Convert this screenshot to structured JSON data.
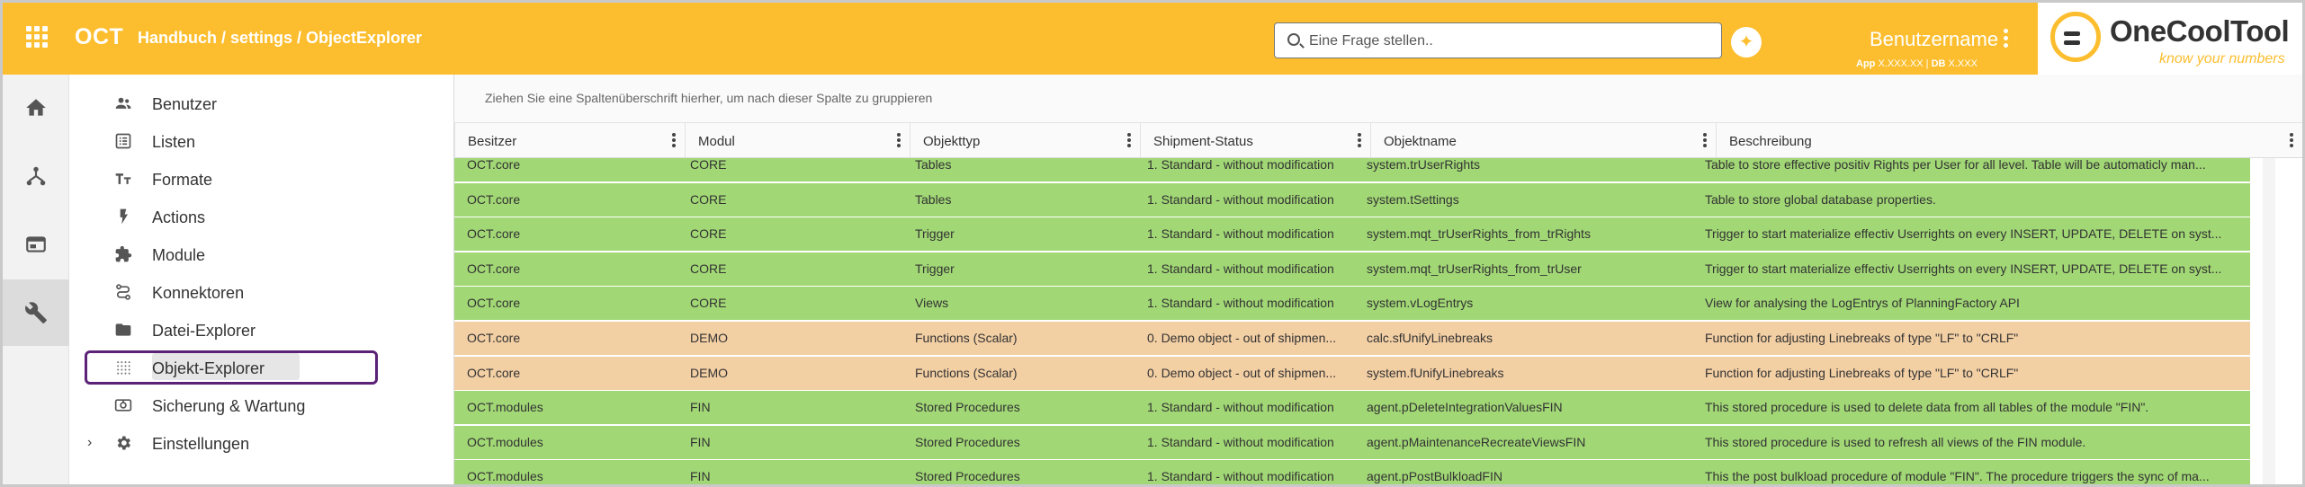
{
  "header": {
    "app_name": "OCT",
    "breadcrumb": "Handbuch / settings / ObjectExplorer",
    "search_placeholder": "Eine Frage stellen..",
    "ai_button_icon": "sparkle-icon",
    "username": "Benutzername",
    "app_version_label": "App",
    "app_version": "X.XXX.XX",
    "db_version_label": "DB",
    "db_version": "X.XXX",
    "logo_text": "OneCoolTool",
    "logo_tagline": "know your numbers",
    "accent_color": "#fcbe2e"
  },
  "rail": [
    {
      "icon": "home-icon"
    },
    {
      "icon": "hierarchy-icon"
    },
    {
      "icon": "window-icon"
    },
    {
      "icon": "wrench-icon",
      "active": true
    }
  ],
  "nav": {
    "items": [
      {
        "label": "Benutzer",
        "icon": "users-icon"
      },
      {
        "label": "Listen",
        "icon": "list-icon"
      },
      {
        "label": "Formate",
        "icon": "text-format-icon"
      },
      {
        "label": "Actions",
        "icon": "lightning-icon"
      },
      {
        "label": "Module",
        "icon": "puzzle-icon"
      },
      {
        "label": "Konnektoren",
        "icon": "connector-icon"
      },
      {
        "label": "Datei-Explorer",
        "icon": "folder-icon"
      },
      {
        "label": "Objekt-Explorer",
        "icon": "grid-dots-icon",
        "selected": true
      },
      {
        "label": "Sicherung & Wartung",
        "icon": "backup-icon"
      },
      {
        "label": "Einstellungen",
        "icon": "gear-icon",
        "expandable": true
      }
    ]
  },
  "grid": {
    "group_hint": "Ziehen Sie eine Spaltenüberschrift hierher, um nach dieser Spalte zu gruppieren",
    "columns": [
      "Besitzer",
      "Modul",
      "Objekttyp",
      "Shipment-Status",
      "Objektname",
      "Beschreibung"
    ],
    "row_colors": {
      "green": "#a1d775",
      "orange": "#f3cfa4"
    },
    "rows": [
      {
        "status": "green",
        "cells": [
          "OCT.core",
          "CORE",
          "Tables",
          "1. Standard - without modification",
          "system.trUserRights",
          "Table to store effective positiv Rights per User for all level. Table will be automaticly man..."
        ]
      },
      {
        "status": "green",
        "cells": [
          "OCT.core",
          "CORE",
          "Tables",
          "1. Standard - without modification",
          "system.tSettings",
          "Table to store global database properties."
        ]
      },
      {
        "status": "green",
        "cells": [
          "OCT.core",
          "CORE",
          "Trigger",
          "1. Standard - without modification",
          "system.mqt_trUserRights_from_trRights",
          "Trigger to start materialize effectiv Userrights on every INSERT, UPDATE, DELETE on syst..."
        ]
      },
      {
        "status": "green",
        "cells": [
          "OCT.core",
          "CORE",
          "Trigger",
          "1. Standard - without modification",
          "system.mqt_trUserRights_from_trUser",
          "Trigger to start materialize effectiv Userrights on every INSERT, UPDATE, DELETE on syst..."
        ]
      },
      {
        "status": "green",
        "cells": [
          "OCT.core",
          "CORE",
          "Views",
          "1. Standard - without modification",
          "system.vLogEntrys",
          "View for analysing the LogEntrys of PlanningFactory API"
        ]
      },
      {
        "status": "orange",
        "cells": [
          "OCT.core",
          "DEMO",
          "Functions (Scalar)",
          "0. Demo object - out of shipmen...",
          "calc.sfUnifyLinebreaks",
          "Function for adjusting Linebreaks of type \"LF\" to \"CRLF\""
        ]
      },
      {
        "status": "orange",
        "cells": [
          "OCT.core",
          "DEMO",
          "Functions (Scalar)",
          "0. Demo object - out of shipmen...",
          "system.fUnifyLinebreaks",
          "Function for adjusting Linebreaks of type \"LF\" to \"CRLF\""
        ]
      },
      {
        "status": "green",
        "cells": [
          "OCT.modules",
          "FIN",
          "Stored Procedures",
          "1. Standard - without modification",
          "agent.pDeleteIntegrationValuesFIN",
          "This stored procedure is used to delete data from all tables of the module \"FIN\"."
        ]
      },
      {
        "status": "green",
        "cells": [
          "OCT.modules",
          "FIN",
          "Stored Procedures",
          "1. Standard - without modification",
          "agent.pMaintenanceRecreateViewsFIN",
          "This stored procedure is used to refresh all views of the FIN module."
        ]
      },
      {
        "status": "green",
        "cells": [
          "OCT.modules",
          "FIN",
          "Stored Procedures",
          "1. Standard - without modification",
          "agent.pPostBulkloadFIN",
          "This the post bulkload procedure of module \"FIN\". The procedure triggers the sync of ma..."
        ]
      }
    ]
  }
}
